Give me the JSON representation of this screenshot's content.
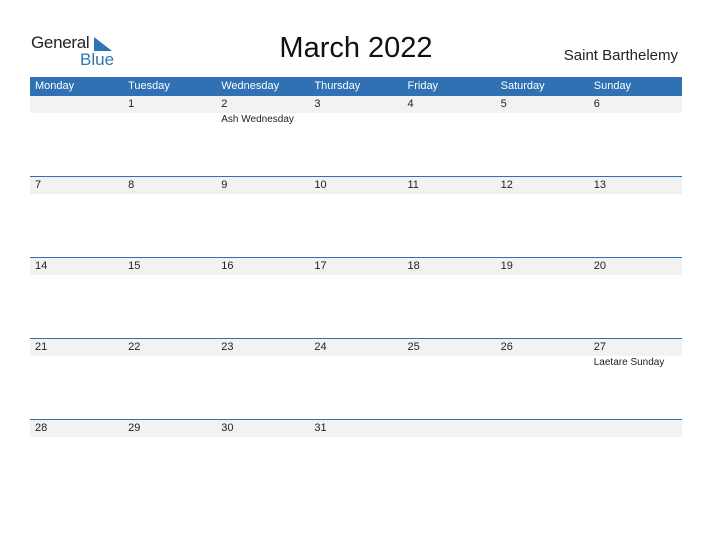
{
  "logo": {
    "word1": "General",
    "word2": "Blue"
  },
  "title": "March 2022",
  "country": "Saint Barthelemy",
  "colors": {
    "accent": "#2f71b3",
    "date_strip": "#f2f2f2"
  },
  "weekdays": [
    "Monday",
    "Tuesday",
    "Wednesday",
    "Thursday",
    "Friday",
    "Saturday",
    "Sunday"
  ],
  "weeks": [
    {
      "days": [
        {
          "num": "",
          "event": ""
        },
        {
          "num": "1",
          "event": ""
        },
        {
          "num": "2",
          "event": "Ash Wednesday"
        },
        {
          "num": "3",
          "event": ""
        },
        {
          "num": "4",
          "event": ""
        },
        {
          "num": "5",
          "event": ""
        },
        {
          "num": "6",
          "event": ""
        }
      ]
    },
    {
      "days": [
        {
          "num": "7",
          "event": ""
        },
        {
          "num": "8",
          "event": ""
        },
        {
          "num": "9",
          "event": ""
        },
        {
          "num": "10",
          "event": ""
        },
        {
          "num": "11",
          "event": ""
        },
        {
          "num": "12",
          "event": ""
        },
        {
          "num": "13",
          "event": ""
        }
      ]
    },
    {
      "days": [
        {
          "num": "14",
          "event": ""
        },
        {
          "num": "15",
          "event": ""
        },
        {
          "num": "16",
          "event": ""
        },
        {
          "num": "17",
          "event": ""
        },
        {
          "num": "18",
          "event": ""
        },
        {
          "num": "19",
          "event": ""
        },
        {
          "num": "20",
          "event": ""
        }
      ]
    },
    {
      "days": [
        {
          "num": "21",
          "event": ""
        },
        {
          "num": "22",
          "event": ""
        },
        {
          "num": "23",
          "event": ""
        },
        {
          "num": "24",
          "event": ""
        },
        {
          "num": "25",
          "event": ""
        },
        {
          "num": "26",
          "event": ""
        },
        {
          "num": "27",
          "event": "Laetare Sunday"
        }
      ]
    },
    {
      "days": [
        {
          "num": "28",
          "event": ""
        },
        {
          "num": "29",
          "event": ""
        },
        {
          "num": "30",
          "event": ""
        },
        {
          "num": "31",
          "event": ""
        }
      ]
    }
  ]
}
